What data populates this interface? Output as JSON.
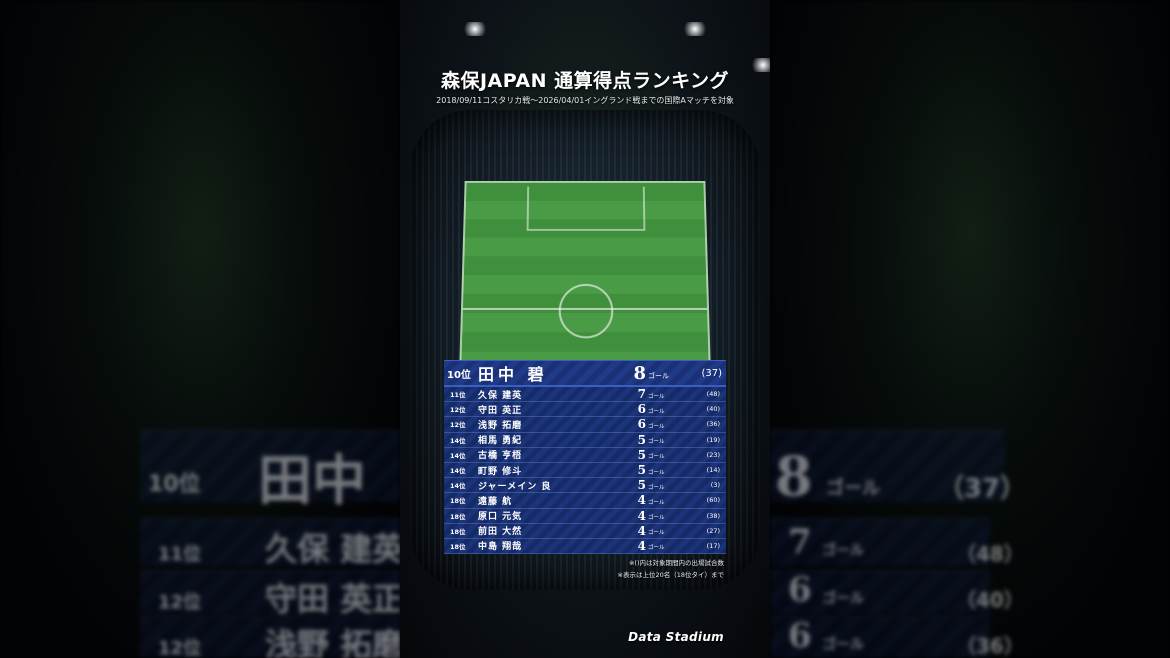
{
  "title": "森保JAPAN 通算得点ランキング",
  "subtitle": "2018/09/11コスタリカ戦〜2026/04/01イングランド戦までの国際Aマッチを対象",
  "goal_unit": "ゴール",
  "ranking": [
    {
      "rank": "10位",
      "name": "田中 碧",
      "goals": "8",
      "apps": "(37)"
    },
    {
      "rank": "11位",
      "name": "久保 建英",
      "goals": "7",
      "apps": "(48)"
    },
    {
      "rank": "12位",
      "name": "守田 英正",
      "goals": "6",
      "apps": "(40)"
    },
    {
      "rank": "12位",
      "name": "浅野 拓磨",
      "goals": "6",
      "apps": "(36)"
    },
    {
      "rank": "14位",
      "name": "相馬 勇紀",
      "goals": "5",
      "apps": "(19)"
    },
    {
      "rank": "14位",
      "name": "古橋 亨梧",
      "goals": "5",
      "apps": "(23)"
    },
    {
      "rank": "14位",
      "name": "町野 修斗",
      "goals": "5",
      "apps": "(14)"
    },
    {
      "rank": "14位",
      "name": "ジャーメイン 良",
      "goals": "5",
      "apps": "(3)"
    },
    {
      "rank": "18位",
      "name": "遠藤 航",
      "goals": "4",
      "apps": "(60)"
    },
    {
      "rank": "18位",
      "name": "原口 元気",
      "goals": "4",
      "apps": "(38)"
    },
    {
      "rank": "18位",
      "name": "前田 大然",
      "goals": "4",
      "apps": "(27)"
    },
    {
      "rank": "18位",
      "name": "中島 翔哉",
      "goals": "4",
      "apps": "(17)"
    }
  ],
  "notes": [
    "※()内は対象期間内の出場試合数",
    "※表示は上位20名（18位タイ）まで"
  ],
  "logo_text": "Data Stadium",
  "background": {
    "top": {
      "rank": "10位",
      "name": "田中",
      "goals": "8",
      "apps": "（37）"
    },
    "rows": [
      {
        "rank": "11位",
        "name": "久保 建英",
        "goals": "7",
        "apps": "（48）"
      },
      {
        "rank": "12位",
        "name": "守田 英正",
        "goals": "6",
        "apps": "（40）"
      },
      {
        "rank": "12位",
        "name": "浅野 拓磨",
        "goals": "6",
        "apps": "（36）"
      }
    ]
  },
  "colors": {
    "row_blue": "#1c3680",
    "row_border": "#3a5fc0",
    "pitch_green": "#4a9b45"
  }
}
